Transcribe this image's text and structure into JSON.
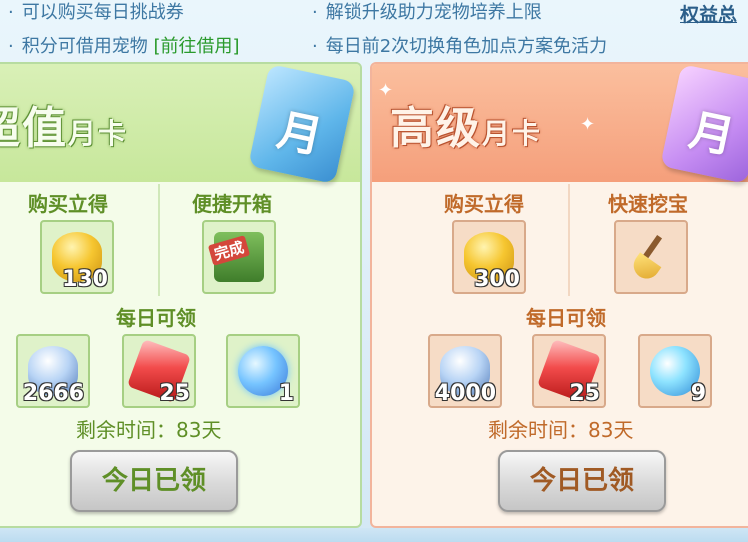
{
  "top": {
    "bullets": [
      {
        "text": "可以购买每日挑战券"
      },
      {
        "text": "积分可借用宠物",
        "link": "[前往借用]"
      },
      {
        "text": "解锁升级助力宠物培养上限"
      },
      {
        "text": "每日前2次切换角色加点方案免活力"
      }
    ],
    "bullet_mark": "·",
    "rights_link": "权益总"
  },
  "cards": [
    {
      "title_main": "超值",
      "title_small": "月卡",
      "book_char": "月",
      "col1_label": "购买立得",
      "col2_label": "便捷开箱",
      "instant": {
        "icon": "gold-ingot-icon",
        "qty": "130"
      },
      "feature": {
        "icon": "treasure-chest-icon",
        "stamp": "完成"
      },
      "daily_label": "每日可领",
      "daily_items": [
        {
          "icon": "silver-ingot-icon",
          "qty": "2666"
        },
        {
          "icon": "ruby-gem-icon",
          "qty": "25"
        },
        {
          "icon": "magic-orb-icon",
          "qty": "1"
        }
      ],
      "remaining": "剩余时间：83天",
      "button": "今日已领"
    },
    {
      "title_main": "高级",
      "title_small": "月卡",
      "book_char": "月",
      "col1_label": "购买立得",
      "col2_label": "快速挖宝",
      "instant": {
        "icon": "gold-ingot-icon",
        "qty": "300"
      },
      "feature": {
        "icon": "golden-shovel-icon"
      },
      "daily_label": "每日可领",
      "daily_items": [
        {
          "icon": "silver-ingot-icon",
          "qty": "4000"
        },
        {
          "icon": "ruby-gem-icon",
          "qty": "25"
        },
        {
          "icon": "swirl-orb-icon",
          "qty": "9"
        }
      ],
      "remaining": "剩余时间：83天",
      "button": "今日已领"
    }
  ],
  "colors": {
    "green_card_bg": "#f4fce9",
    "red_card_bg": "#fdf3e9",
    "green_text": "#5f8f27",
    "orange_text": "#c06a2a",
    "link_green": "#2a9a2c",
    "bullet_blue": "#3e78a3"
  }
}
